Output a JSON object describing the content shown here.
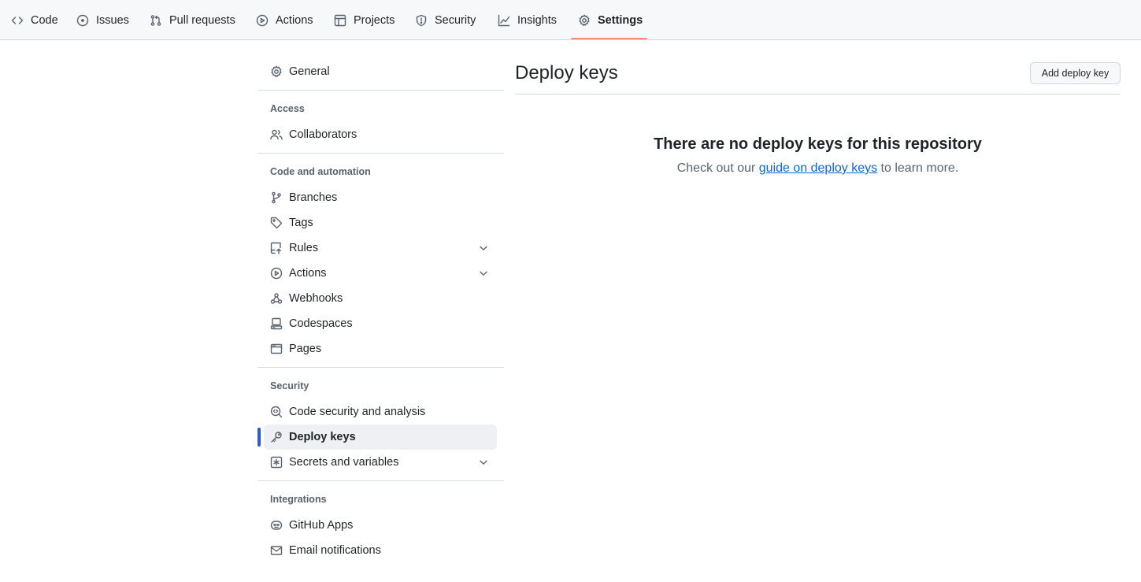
{
  "topnav": {
    "tabs": [
      {
        "label": "Code",
        "icon": "code-icon"
      },
      {
        "label": "Issues",
        "icon": "issue-opened-icon"
      },
      {
        "label": "Pull requests",
        "icon": "git-pull-request-icon"
      },
      {
        "label": "Actions",
        "icon": "play-icon"
      },
      {
        "label": "Projects",
        "icon": "table-icon"
      },
      {
        "label": "Security",
        "icon": "shield-icon"
      },
      {
        "label": "Insights",
        "icon": "graph-icon"
      },
      {
        "label": "Settings",
        "icon": "gear-icon",
        "active": true
      }
    ],
    "active_underline_color": "#fd8c73"
  },
  "sidebar": {
    "general": "General",
    "sections": {
      "access": {
        "heading": "Access",
        "items": [
          "Collaborators"
        ]
      },
      "code_automation": {
        "heading": "Code and automation",
        "items": [
          "Branches",
          "Tags",
          "Rules",
          "Actions",
          "Webhooks",
          "Codespaces",
          "Pages"
        ]
      },
      "security": {
        "heading": "Security",
        "items": [
          "Code security and analysis",
          "Deploy keys",
          "Secrets and variables"
        ]
      },
      "integrations": {
        "heading": "Integrations",
        "items": [
          "GitHub Apps",
          "Email notifications"
        ]
      }
    },
    "active_item": "Deploy keys",
    "active_bar_color": "#2d5bcf"
  },
  "main": {
    "title": "Deploy keys",
    "add_button": "Add deploy key",
    "blankslate": {
      "heading": "There are no deploy keys for this repository",
      "text_before": "Check out our ",
      "link": "guide on deploy keys",
      "text_after": " to learn more."
    },
    "link_color": "#0969da"
  }
}
